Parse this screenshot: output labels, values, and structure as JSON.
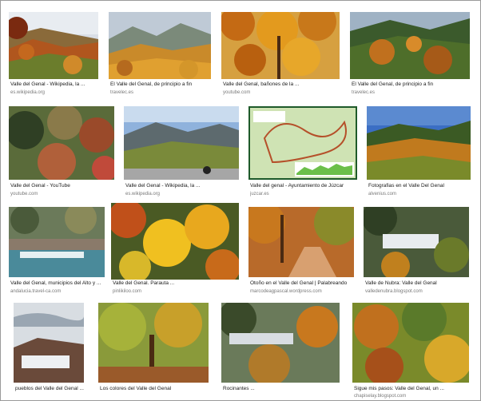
{
  "results": [
    {
      "caption": "Valle del Genal - Wikipedia, la ...",
      "source": "es.wikipedia.org",
      "icon": "image-autumn-valley-hillside"
    },
    {
      "caption": "El Valle del Genal, de principio a fin",
      "source": "travelec.es",
      "icon": "image-golden-forest-mountains"
    },
    {
      "caption": "Valle del Genal, bañones de la ...",
      "source": "youtube.com",
      "icon": "image-orange-chestnut-trees"
    },
    {
      "caption": "El Valle del Genal, de principio a fin",
      "source": "travelec.es",
      "icon": "image-green-orange-forest-valley"
    },
    {
      "caption": "Valle del Genal - YouTube",
      "source": "youtube.com",
      "icon": "image-mixed-autumn-hillside"
    },
    {
      "caption": "Valle del Genal - Wikipedia, la ...",
      "source": "es.wikipedia.org",
      "icon": "image-road-mountain-view"
    },
    {
      "caption": "Valle del genal - Ayuntamiento de Júzcar",
      "source": "juzcar.es",
      "icon": "image-route-map"
    },
    {
      "caption": "Fotografias en el Valle Del Genal",
      "source": "alvenius.com",
      "icon": "image-wide-autumn-valley"
    },
    {
      "caption": "Valle del Genal, municipios del Alto y ...",
      "source": "andalucia.travel-ca.com",
      "icon": "image-waterfall-river"
    },
    {
      "caption": "Valle del Genal. Parauta ...",
      "source": "pinlikiloo.com",
      "icon": "image-bright-yellow-trees"
    },
    {
      "caption": "Otoño en el Valle del Genal | Palabreando",
      "source": "marcodeagpascal.wordpress.com",
      "icon": "image-leafy-forest-path"
    },
    {
      "caption": "Valle de Nubra: Valle del Genal",
      "source": "valledenubra.blogspot.com",
      "icon": "image-white-village-hills"
    },
    {
      "caption": "pueblos del Valle del Genal ...",
      "source": "",
      "icon": "image-white-village-cloudy-sky"
    },
    {
      "caption": "Los colores del Valle del Genal",
      "source": "",
      "icon": "image-chestnut-tree-canopy"
    },
    {
      "caption": "Rocinantes ...",
      "source": "",
      "icon": "image-village-valley-autumn"
    },
    {
      "caption": "Sigue mis pasos: Valle del Genal, un ...",
      "source": "chapiselay.blogspot.com",
      "icon": "image-dense-autumn-forest"
    }
  ]
}
